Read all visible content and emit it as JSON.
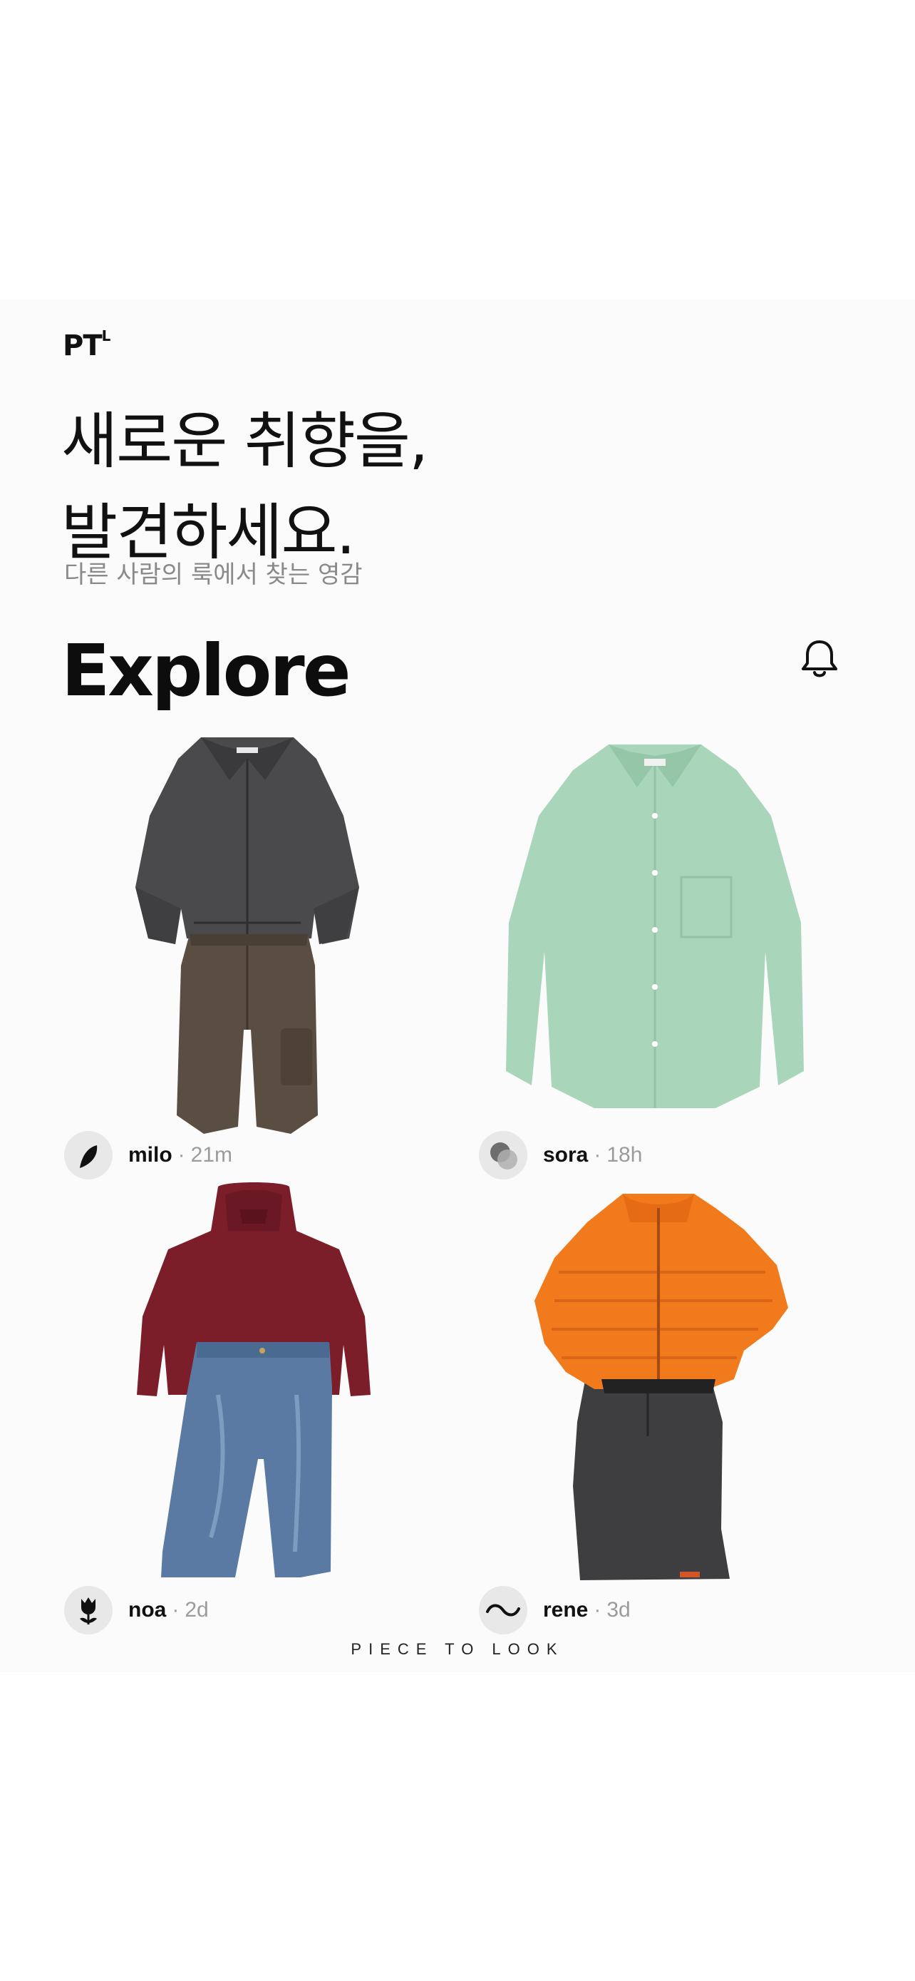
{
  "app": {
    "logo_main": "PT",
    "logo_sup": "L",
    "headline_line1": "새로운 취향을,",
    "headline_line2": "발견하세요.",
    "subtitle": "다른 사람의 룩에서 찾는 영감",
    "section_title": "Explore",
    "footer": "PIECE TO LOOK"
  },
  "looks": [
    {
      "user": "milo",
      "separator": "·",
      "time": "21m",
      "avatar_icon": "crescent-icon",
      "items": [
        "charcoal-jacket",
        "brown-cargo-pants"
      ]
    },
    {
      "user": "sora",
      "separator": "·",
      "time": "18h",
      "avatar_icon": "overlapping-circles-icon",
      "items": [
        "mint-shirt"
      ]
    },
    {
      "user": "noa",
      "separator": "·",
      "time": "2d",
      "avatar_icon": "tulip-icon",
      "items": [
        "burgundy-hoodie",
        "blue-jeans"
      ]
    },
    {
      "user": "rene",
      "separator": "·",
      "time": "3d",
      "avatar_icon": "wave-icon",
      "items": [
        "orange-puffer-jacket",
        "charcoal-skirt"
      ]
    }
  ],
  "colors": {
    "panel_bg": "#fbfbfb",
    "text_primary": "#111111",
    "text_muted": "#8a8a8a"
  }
}
